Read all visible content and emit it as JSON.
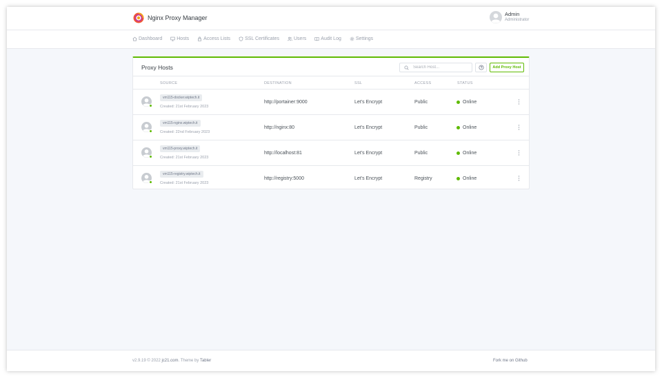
{
  "app": {
    "title": "Nginx Proxy Manager",
    "logo_icon": "nginx-proxy-manager-logo-icon"
  },
  "user": {
    "name": "Admin",
    "role": "Administrator"
  },
  "nav": {
    "items": [
      {
        "label": "Dashboard",
        "icon": "home-icon"
      },
      {
        "label": "Hosts",
        "icon": "monitor-icon"
      },
      {
        "label": "Access Lists",
        "icon": "lock-icon"
      },
      {
        "label": "SSL Certificates",
        "icon": "shield-icon"
      },
      {
        "label": "Users",
        "icon": "users-icon"
      },
      {
        "label": "Audit Log",
        "icon": "book-icon"
      },
      {
        "label": "Settings",
        "icon": "gear-icon"
      }
    ]
  },
  "card": {
    "title": "Proxy Hosts",
    "search_placeholder": "Search Host...",
    "add_button": "Add Proxy Host",
    "help_icon": "help-icon"
  },
  "table": {
    "columns": [
      "SOURCE",
      "DESTINATION",
      "SSL",
      "ACCESS",
      "STATUS"
    ],
    "rows": [
      {
        "domain": "vm115-docker.wiptech.it",
        "created": "Created: 21st February 2023",
        "destination": "http://portainer:9000",
        "ssl": "Let's Encrypt",
        "access": "Public",
        "status": "Online"
      },
      {
        "domain": "vm115-nginx.wiptech.it",
        "created": "Created: 22nd February 2023",
        "destination": "http://nginx:80",
        "ssl": "Let's Encrypt",
        "access": "Public",
        "status": "Online"
      },
      {
        "domain": "vm115-proxy.wiptech.it",
        "created": "Created: 21st February 2023",
        "destination": "http://localhost:81",
        "ssl": "Let's Encrypt",
        "access": "Public",
        "status": "Online"
      },
      {
        "domain": "vm115-registry.wiptech.it",
        "created": "Created: 21st February 2023",
        "destination": "http://registry:5000",
        "ssl": "Let's Encrypt",
        "access": "Registry",
        "status": "Online"
      }
    ]
  },
  "footer": {
    "version": "v2.9.19 © 2022",
    "author_link": "jc21.com",
    "theme_text": ". Theme by",
    "theme_link": "Tabler",
    "github_link": "Fork me on Github"
  },
  "colors": {
    "accent": "#5eba00",
    "background": "#f5f7fb"
  }
}
